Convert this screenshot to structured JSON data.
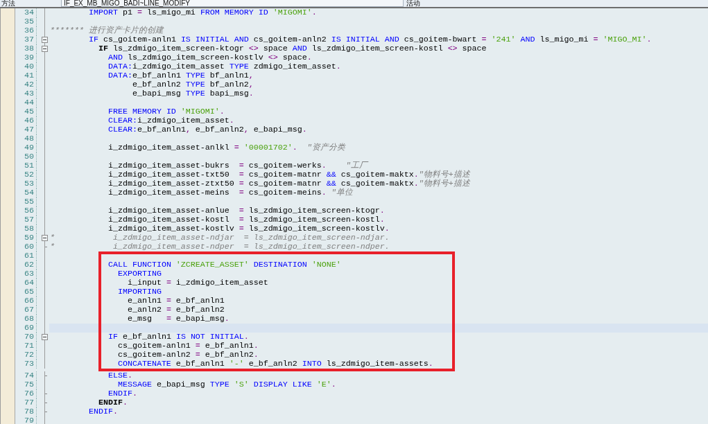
{
  "header": {
    "label": "方法",
    "method": "IF_EX_MB_MIGO_BADI~LINE_MODIFY",
    "status": "活动"
  },
  "editor": {
    "blocks": [
      {
        "boxed": false,
        "lines": [
          {
            "number": "34",
            "current": false,
            "kind": "line",
            "code": [
              {
                "kind": "keyword",
                "text": "        IMPORT"
              },
              {
                "kind": "plain",
                "text": " p1 "
              },
              {
                "kind": "operator",
                "text": "="
              },
              {
                "kind": "plain",
                "text": " ls_migo_mi "
              },
              {
                "kind": "keyword",
                "text": "FROM MEMORY ID"
              },
              {
                "kind": "string",
                "text": " 'MIGOMI'"
              },
              {
                "kind": "operator",
                "text": "."
              }
            ]
          },
          {
            "number": "35",
            "current": false,
            "kind": "line"
          },
          {
            "number": "36",
            "current": false,
            "kind": "line",
            "code": [
              {
                "kind": "comment",
                "text": "******* 进行资产卡片的创建"
              }
            ]
          },
          {
            "number": "37",
            "current": false,
            "kind": "fold_start",
            "code": [
              {
                "kind": "keyword",
                "text": "        IF"
              },
              {
                "kind": "plain",
                "text": " cs_goitem-anln1 "
              },
              {
                "kind": "keyword",
                "text": "IS INITIAL AND"
              },
              {
                "kind": "plain",
                "text": " cs_goitem-anln2 "
              },
              {
                "kind": "keyword",
                "text": "IS INITIAL AND"
              },
              {
                "kind": "plain",
                "text": " cs_goitem-bwart "
              },
              {
                "kind": "operator",
                "text": "="
              },
              {
                "kind": "string",
                "text": " '241'"
              },
              {
                "kind": "keyword",
                "text": " AND"
              },
              {
                "kind": "plain",
                "text": " ls_migo_mi "
              },
              {
                "kind": "operator",
                "text": "="
              },
              {
                "kind": "string",
                "text": " 'MIGO_MI'"
              },
              {
                "kind": "operator",
                "text": "."
              }
            ]
          },
          {
            "number": "38",
            "current": false,
            "kind": "fold_start",
            "code": [
              {
                "kind": "matched",
                "text": "          IF"
              },
              {
                "kind": "plain",
                "text": " ls_zdmigo_item_screen-ktogr "
              },
              {
                "kind": "operator",
                "text": "<>"
              },
              {
                "kind": "plain",
                "text": " space "
              },
              {
                "kind": "keyword",
                "text": "AND"
              },
              {
                "kind": "plain",
                "text": " ls_zdmigo_item_screen-kostl "
              },
              {
                "kind": "operator",
                "text": "<>"
              },
              {
                "kind": "plain",
                "text": " space"
              }
            ]
          },
          {
            "number": "39",
            "current": false,
            "kind": "line",
            "code": [
              {
                "kind": "keyword",
                "text": "            AND"
              },
              {
                "kind": "plain",
                "text": " ls_zdmigo_item_screen-kostlv "
              },
              {
                "kind": "operator",
                "text": "<>"
              },
              {
                "kind": "plain",
                "text": " space"
              },
              {
                "kind": "operator",
                "text": "."
              }
            ]
          },
          {
            "number": "40",
            "current": false,
            "kind": "line",
            "code": [
              {
                "kind": "keyword",
                "text": "            DATA:"
              },
              {
                "kind": "plain",
                "text": "i_zdmigo_item_asset "
              },
              {
                "kind": "keyword",
                "text": "TYPE"
              },
              {
                "kind": "plain",
                "text": " zdmigo_item_asset"
              },
              {
                "kind": "operator",
                "text": "."
              }
            ]
          },
          {
            "number": "41",
            "current": false,
            "kind": "line",
            "code": [
              {
                "kind": "keyword",
                "text": "            DATA:"
              },
              {
                "kind": "plain",
                "text": "e_bf_anln1 "
              },
              {
                "kind": "keyword",
                "text": "TYPE"
              },
              {
                "kind": "plain",
                "text": " bf_anln1"
              },
              {
                "kind": "operator",
                "text": ","
              }
            ]
          },
          {
            "number": "42",
            "current": false,
            "kind": "line",
            "code": [
              {
                "kind": "plain",
                "text": "                 e_bf_anln2 "
              },
              {
                "kind": "keyword",
                "text": "TYPE"
              },
              {
                "kind": "plain",
                "text": " bf_anln2"
              },
              {
                "kind": "operator",
                "text": ","
              }
            ]
          },
          {
            "number": "43",
            "current": false,
            "kind": "line",
            "code": [
              {
                "kind": "plain",
                "text": "                 e_bapi_msg "
              },
              {
                "kind": "keyword",
                "text": "TYPE"
              },
              {
                "kind": "plain",
                "text": " bapi_msg"
              },
              {
                "kind": "operator",
                "text": "."
              }
            ]
          },
          {
            "number": "44",
            "current": false,
            "kind": "line"
          },
          {
            "number": "45",
            "current": false,
            "kind": "line",
            "code": [
              {
                "kind": "keyword",
                "text": "            FREE MEMORY ID"
              },
              {
                "kind": "string",
                "text": " 'MIGOMI'"
              },
              {
                "kind": "operator",
                "text": "."
              }
            ]
          },
          {
            "number": "46",
            "current": false,
            "kind": "line",
            "code": [
              {
                "kind": "keyword",
                "text": "            CLEAR:"
              },
              {
                "kind": "plain",
                "text": "i_zdmigo_item_asset"
              },
              {
                "kind": "operator",
                "text": "."
              }
            ]
          },
          {
            "number": "47",
            "current": false,
            "kind": "line",
            "code": [
              {
                "kind": "keyword",
                "text": "            CLEAR:"
              },
              {
                "kind": "plain",
                "text": "e_bf_anln1"
              },
              {
                "kind": "operator",
                "text": ","
              },
              {
                "kind": "plain",
                "text": " e_bf_anln2"
              },
              {
                "kind": "operator",
                "text": ","
              },
              {
                "kind": "plain",
                "text": " e_bapi_msg"
              },
              {
                "kind": "operator",
                "text": "."
              }
            ]
          },
          {
            "number": "48",
            "current": false,
            "kind": "line"
          },
          {
            "number": "49",
            "current": false,
            "kind": "line",
            "code": [
              {
                "kind": "plain",
                "text": "            i_zdmigo_item_asset-anlkl "
              },
              {
                "kind": "operator",
                "text": "="
              },
              {
                "kind": "string",
                "text": " '00001702'"
              },
              {
                "kind": "operator",
                "text": "."
              },
              {
                "kind": "comment",
                "text": "  \"资产分类"
              }
            ]
          },
          {
            "number": "50",
            "current": false,
            "kind": "line"
          },
          {
            "number": "51",
            "current": false,
            "kind": "line",
            "code": [
              {
                "kind": "plain",
                "text": "            i_zdmigo_item_asset-bukrs  "
              },
              {
                "kind": "operator",
                "text": "="
              },
              {
                "kind": "plain",
                "text": " cs_goitem-werks"
              },
              {
                "kind": "operator",
                "text": "."
              },
              {
                "kind": "comment",
                "text": "    \"工厂"
              }
            ]
          },
          {
            "number": "52",
            "current": false,
            "kind": "line",
            "code": [
              {
                "kind": "plain",
                "text": "            i_zdmigo_item_asset-txt50  "
              },
              {
                "kind": "operator",
                "text": "="
              },
              {
                "kind": "plain",
                "text": " cs_goitem-matnr "
              },
              {
                "kind": "keyword",
                "text": "&&"
              },
              {
                "kind": "plain",
                "text": " cs_goitem-maktx"
              },
              {
                "kind": "operator",
                "text": "."
              },
              {
                "kind": "comment",
                "text": "\"物料号+描述"
              }
            ]
          },
          {
            "number": "53",
            "current": false,
            "kind": "line",
            "code": [
              {
                "kind": "plain",
                "text": "            i_zdmigo_item_asset-ztxt50 "
              },
              {
                "kind": "operator",
                "text": "="
              },
              {
                "kind": "plain",
                "text": " cs_goitem-matnr "
              },
              {
                "kind": "keyword",
                "text": "&&"
              },
              {
                "kind": "plain",
                "text": " cs_goitem-maktx"
              },
              {
                "kind": "operator",
                "text": "."
              },
              {
                "kind": "comment",
                "text": "\"物料号+描述"
              }
            ]
          },
          {
            "number": "54",
            "current": false,
            "kind": "line",
            "code": [
              {
                "kind": "plain",
                "text": "            i_zdmigo_item_asset-meins  "
              },
              {
                "kind": "operator",
                "text": "="
              },
              {
                "kind": "plain",
                "text": " cs_goitem-meins"
              },
              {
                "kind": "operator",
                "text": "."
              },
              {
                "kind": "comment",
                "text": " \"单位"
              }
            ]
          },
          {
            "number": "55",
            "current": false,
            "kind": "line"
          },
          {
            "number": "56",
            "current": false,
            "kind": "line",
            "code": [
              {
                "kind": "plain",
                "text": "            i_zdmigo_item_asset-anlue  "
              },
              {
                "kind": "operator",
                "text": "="
              },
              {
                "kind": "plain",
                "text": " ls_zdmigo_item_screen-ktogr"
              },
              {
                "kind": "operator",
                "text": "."
              }
            ]
          },
          {
            "number": "57",
            "current": false,
            "kind": "line",
            "code": [
              {
                "kind": "plain",
                "text": "            i_zdmigo_item_asset-kostl  "
              },
              {
                "kind": "operator",
                "text": "="
              },
              {
                "kind": "plain",
                "text": " ls_zdmigo_item_screen-kostl"
              },
              {
                "kind": "operator",
                "text": "."
              }
            ]
          },
          {
            "number": "58",
            "current": false,
            "kind": "line",
            "code": [
              {
                "kind": "plain",
                "text": "            i_zdmigo_item_asset-kostlv "
              },
              {
                "kind": "operator",
                "text": "="
              },
              {
                "kind": "plain",
                "text": " ls_zdmigo_item_screen-kostlv"
              },
              {
                "kind": "operator",
                "text": "."
              }
            ]
          },
          {
            "number": "59",
            "current": false,
            "kind": "fold_start",
            "code": [
              {
                "kind": "comment",
                "text": "*            i_zdmigo_item_asset-ndjar  = ls_zdmigo_item_screen-ndjar."
              }
            ]
          },
          {
            "number": "60",
            "current": false,
            "kind": "fold_end",
            "code": [
              {
                "kind": "comment",
                "text": "*            i_zdmigo_item_asset-ndper  = ls_zdmigo_item_screen-ndper."
              }
            ]
          }
        ]
      },
      {
        "boxed": true,
        "lines": [
          {
            "number": "61",
            "current": false,
            "kind": "line"
          },
          {
            "number": "62",
            "current": false,
            "kind": "line",
            "code": [
              {
                "kind": "keyword",
                "text": "            CALL FUNCTION"
              },
              {
                "kind": "string",
                "text": " 'ZCREATE_ASSET'"
              },
              {
                "kind": "keyword",
                "text": " DESTINATION"
              },
              {
                "kind": "string",
                "text": " 'NONE'"
              }
            ]
          },
          {
            "number": "63",
            "current": false,
            "kind": "line",
            "code": [
              {
                "kind": "keyword",
                "text": "              EXPORTING"
              }
            ]
          },
          {
            "number": "64",
            "current": false,
            "kind": "line",
            "code": [
              {
                "kind": "plain",
                "text": "                i_input "
              },
              {
                "kind": "operator",
                "text": "="
              },
              {
                "kind": "plain",
                "text": " i_zdmigo_item_asset"
              }
            ]
          },
          {
            "number": "65",
            "current": false,
            "kind": "line",
            "code": [
              {
                "kind": "keyword",
                "text": "              IMPORTING"
              }
            ]
          },
          {
            "number": "66",
            "current": false,
            "kind": "line",
            "code": [
              {
                "kind": "plain",
                "text": "                e_anln1 "
              },
              {
                "kind": "operator",
                "text": "="
              },
              {
                "kind": "plain",
                "text": " e_bf_anln1"
              }
            ]
          },
          {
            "number": "67",
            "current": false,
            "kind": "line",
            "code": [
              {
                "kind": "plain",
                "text": "                e_anln2 "
              },
              {
                "kind": "operator",
                "text": "="
              },
              {
                "kind": "plain",
                "text": " e_bf_anln2"
              }
            ]
          },
          {
            "number": "68",
            "current": false,
            "kind": "line",
            "code": [
              {
                "kind": "plain",
                "text": "                e_msg   "
              },
              {
                "kind": "operator",
                "text": "="
              },
              {
                "kind": "plain",
                "text": " e_bapi_msg"
              },
              {
                "kind": "operator",
                "text": "."
              }
            ]
          },
          {
            "number": "69",
            "current": true,
            "kind": "line"
          },
          {
            "number": "70",
            "current": false,
            "kind": "fold_start",
            "code": [
              {
                "kind": "keyword",
                "text": "            IF"
              },
              {
                "kind": "plain",
                "text": " e_bf_anln1 "
              },
              {
                "kind": "keyword",
                "text": "IS NOT INITIAL"
              },
              {
                "kind": "operator",
                "text": "."
              }
            ]
          },
          {
            "number": "71",
            "current": false,
            "kind": "line",
            "code": [
              {
                "kind": "plain",
                "text": "              cs_goitem-anln1 "
              },
              {
                "kind": "operator",
                "text": "="
              },
              {
                "kind": "plain",
                "text": " e_bf_anln1"
              },
              {
                "kind": "operator",
                "text": "."
              }
            ]
          },
          {
            "number": "72",
            "current": false,
            "kind": "line",
            "code": [
              {
                "kind": "plain",
                "text": "              cs_goitem-anln2 "
              },
              {
                "kind": "operator",
                "text": "="
              },
              {
                "kind": "plain",
                "text": " e_bf_anln2"
              },
              {
                "kind": "operator",
                "text": "."
              }
            ]
          },
          {
            "number": "73",
            "current": false,
            "kind": "line",
            "code": [
              {
                "kind": "keyword",
                "text": "              CONCATENATE"
              },
              {
                "kind": "plain",
                "text": " e_bf_anln1 "
              },
              {
                "kind": "string",
                "text": "'-'"
              },
              {
                "kind": "plain",
                "text": " e_bf_anln2 "
              },
              {
                "kind": "keyword",
                "text": "INTO"
              },
              {
                "kind": "plain",
                "text": " ls_zdmigo_item-assets"
              },
              {
                "kind": "operator",
                "text": "."
              }
            ]
          }
        ]
      },
      {
        "boxed": false,
        "lines": [
          {
            "number": "74",
            "current": false,
            "kind": "fold_end",
            "code": [
              {
                "kind": "keyword",
                "text": "            ELSE"
              },
              {
                "kind": "operator",
                "text": "."
              }
            ]
          },
          {
            "number": "75",
            "current": false,
            "kind": "line",
            "code": [
              {
                "kind": "keyword",
                "text": "              MESSAGE"
              },
              {
                "kind": "plain",
                "text": " e_bapi_msg "
              },
              {
                "kind": "keyword",
                "text": "TYPE"
              },
              {
                "kind": "string",
                "text": " 'S'"
              },
              {
                "kind": "keyword",
                "text": " DISPLAY LIKE"
              },
              {
                "kind": "string",
                "text": " 'E'"
              },
              {
                "kind": "operator",
                "text": "."
              }
            ]
          },
          {
            "number": "76",
            "current": false,
            "kind": "fold_end",
            "code": [
              {
                "kind": "keyword",
                "text": "            ENDIF"
              },
              {
                "kind": "operator",
                "text": "."
              }
            ]
          },
          {
            "number": "77",
            "current": false,
            "kind": "fold_end",
            "code": [
              {
                "kind": "matched",
                "text": "          ENDIF"
              },
              {
                "kind": "operator",
                "text": "."
              }
            ]
          },
          {
            "number": "78",
            "current": false,
            "kind": "fold_end",
            "code": [
              {
                "kind": "keyword",
                "text": "        ENDIF"
              },
              {
                "kind": "operator",
                "text": "."
              }
            ]
          },
          {
            "number": "79",
            "current": false,
            "kind": "line"
          }
        ]
      }
    ]
  }
}
